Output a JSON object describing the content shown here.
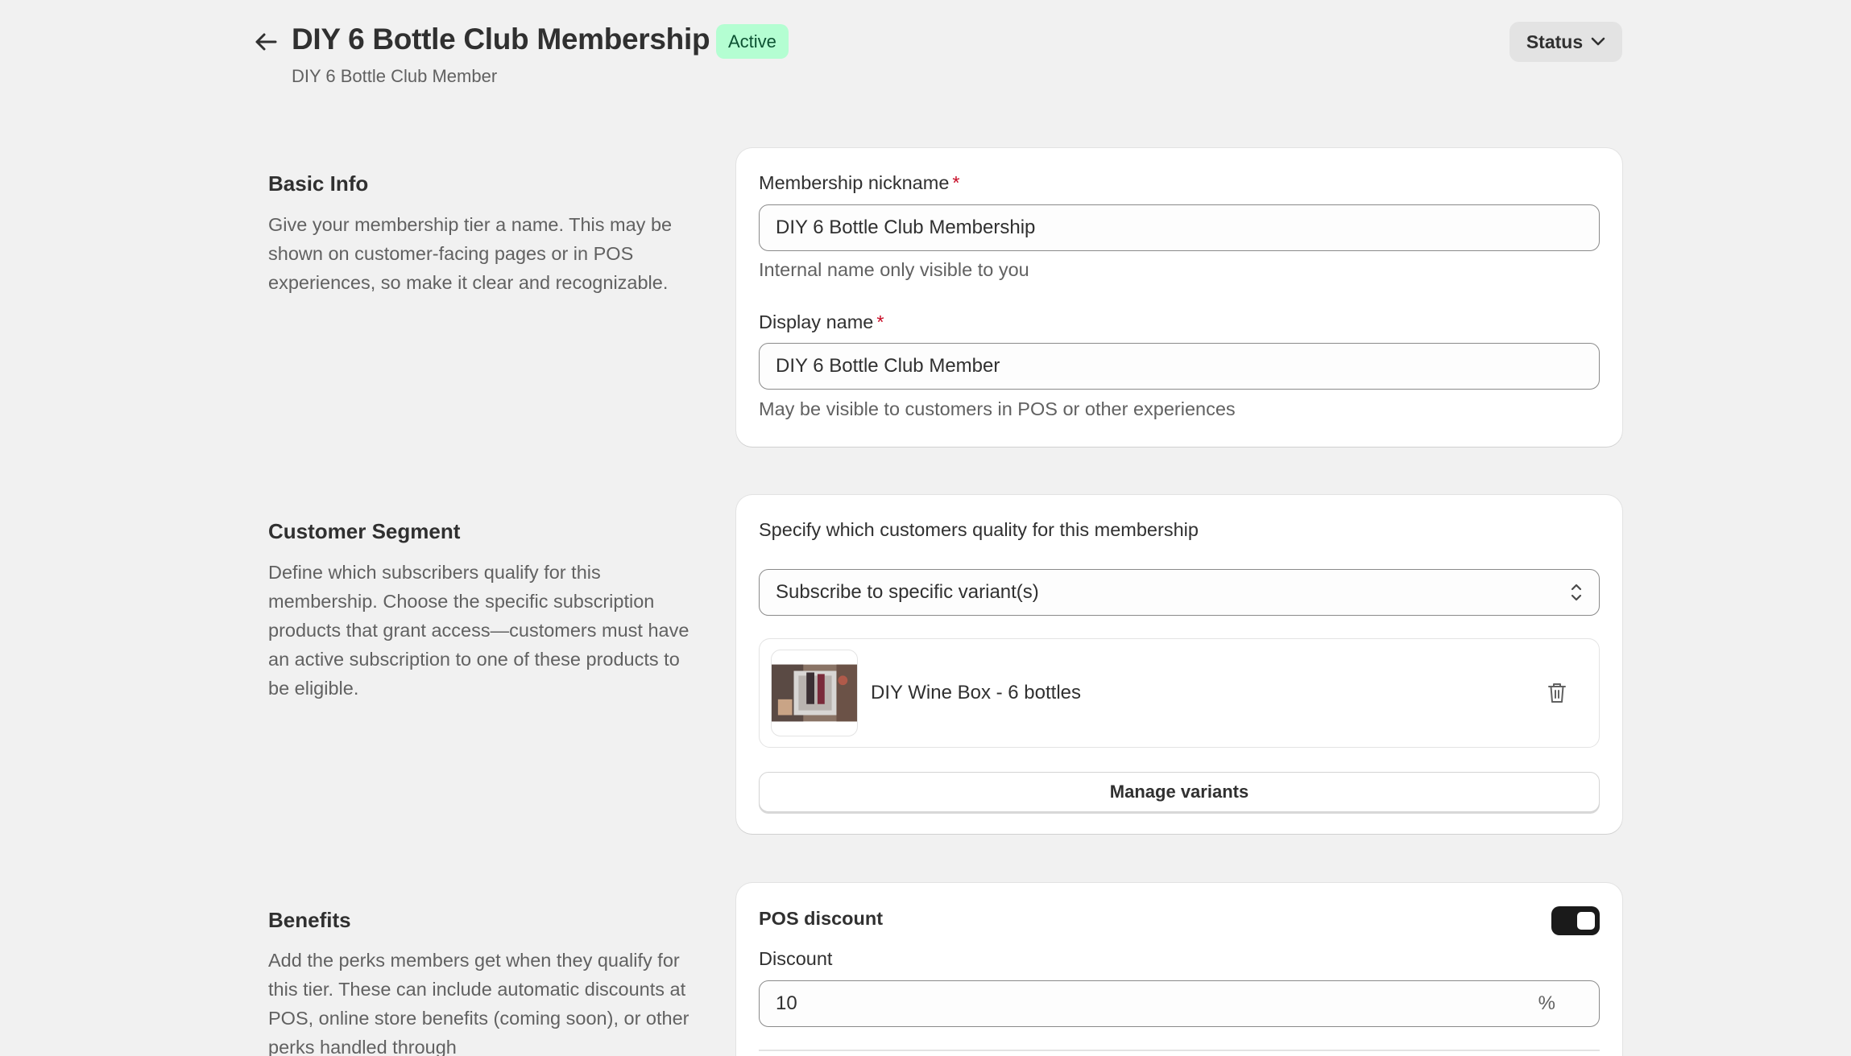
{
  "header": {
    "title": "DIY 6 Bottle Club Membership",
    "status_badge": "Active",
    "subtitle": "DIY 6 Bottle Club Member",
    "status_button": "Status"
  },
  "basic_info": {
    "title": "Basic Info",
    "description": "Give your membership tier a name. This may be shown on customer-facing pages or in POS experiences, so make it clear and recognizable.",
    "nickname_label": "Membership nickname",
    "nickname_required": "*",
    "nickname_value": "DIY 6 Bottle Club Membership",
    "nickname_help": "Internal name only visible to you",
    "display_label": "Display name",
    "display_required": "*",
    "display_value": "DIY 6 Bottle Club Member",
    "display_help": "May be visible to customers in POS or other experiences"
  },
  "customer_segment": {
    "title": "Customer Segment",
    "description": "Define which subscribers qualify for this membership. Choose the specific subscription products that grant access—customers must have an active subscription to one of these products to be eligible.",
    "prompt": "Specify which customers quality for this membership",
    "select_value": "Subscribe to specific variant(s)",
    "variant_name": "DIY Wine Box - 6 bottles",
    "manage_button": "Manage variants"
  },
  "benefits": {
    "title": "Benefits",
    "description": "Add the perks members get when they qualify for this tier. These can include automatic discounts at POS, online store benefits (coming soon), or other perks handled through",
    "pos_discount_label": "POS discount",
    "pos_discount_enabled": true,
    "discount_label": "Discount",
    "discount_value": "10",
    "discount_suffix": "%"
  },
  "colors": {
    "background": "#f1f1f1",
    "card": "#ffffff",
    "badge_bg": "#b4fed2",
    "badge_text": "#0c5132",
    "required": "#c70a24",
    "toggle_on": "#1a1a1a"
  }
}
